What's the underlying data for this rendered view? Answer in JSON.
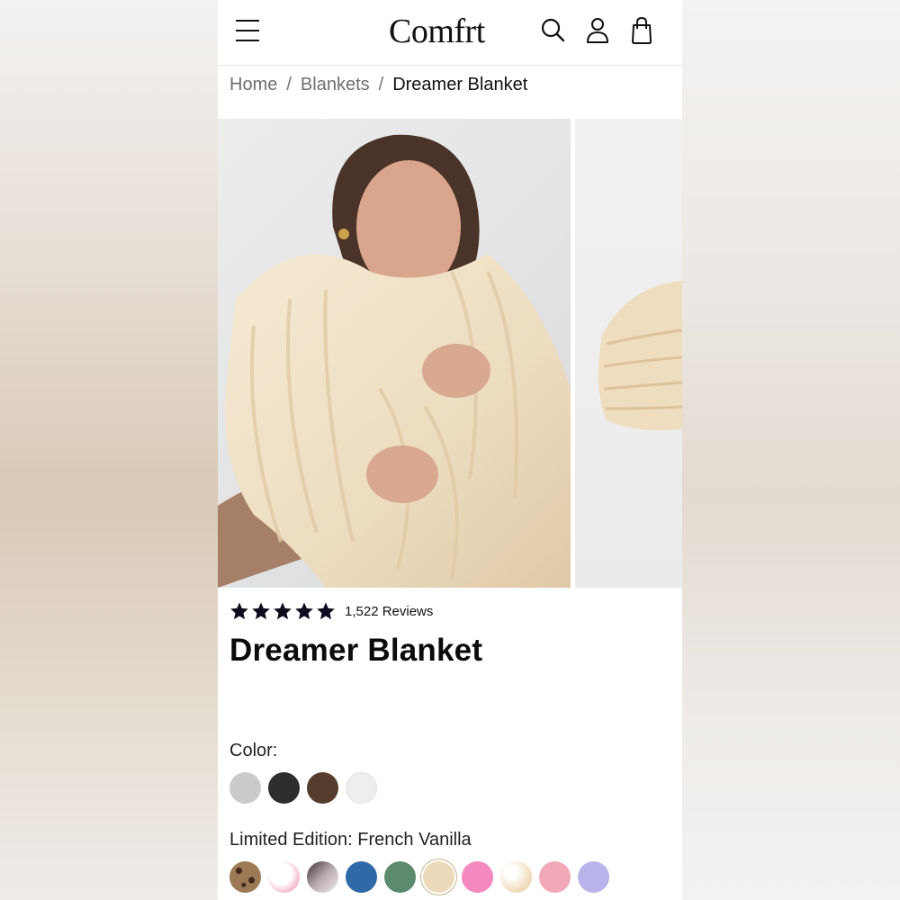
{
  "brand": {
    "logo": "Comfrt"
  },
  "header": {
    "icons": [
      "menu-icon",
      "search-icon",
      "account-icon",
      "bag-icon"
    ]
  },
  "breadcrumb": {
    "items": [
      "Home",
      "Blankets",
      "Dreamer Blanket"
    ],
    "separator": "/"
  },
  "product": {
    "rating_stars": 5,
    "reviews_label": "1,522 Reviews",
    "title": "Dreamer Blanket"
  },
  "color_section": {
    "label": "Color:",
    "swatches": [
      {
        "name": "grey",
        "hex": "#cbcbcb"
      },
      {
        "name": "charcoal",
        "hex": "#2e2e2e"
      },
      {
        "name": "brown",
        "hex": "#553d2e"
      },
      {
        "name": "white",
        "hex": "#eeeeee"
      }
    ]
  },
  "limited_section": {
    "label": "Limited Edition: French Vanilla",
    "swatches": [
      {
        "name": "leopard",
        "hex": "#8a6a4c"
      },
      {
        "name": "pink-white",
        "hex": "#f4c9d4"
      },
      {
        "name": "smoke",
        "hex": "#6e5c63"
      },
      {
        "name": "blue",
        "hex": "#2f6aa6"
      },
      {
        "name": "sage",
        "hex": "#5c8a6c"
      },
      {
        "name": "french-vanilla",
        "hex": "#ecd9b9",
        "selected": true
      },
      {
        "name": "hot-pink",
        "hex": "#f489bf"
      },
      {
        "name": "cream-swirl",
        "hex": "#f1e0c6"
      },
      {
        "name": "light-pink",
        "hex": "#f2a9b7"
      },
      {
        "name": "lavender",
        "hex": "#b9b5ea"
      }
    ]
  }
}
